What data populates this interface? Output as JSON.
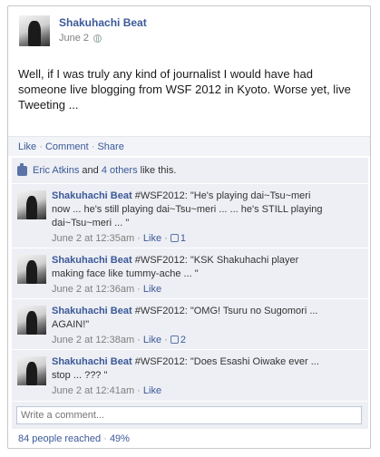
{
  "post": {
    "author": "Shakuhachi Beat",
    "date": "June 2",
    "text": "Well, if I was truly any kind of journalist I would have had someone live blogging from WSF 2012 in Kyoto. Worse yet, live Tweeting ...",
    "actions": {
      "like": "Like",
      "comment": "Comment",
      "share": "Share",
      "separator": "·"
    }
  },
  "likes": {
    "name": "Eric Atkins",
    "and": "and",
    "others": "4 others",
    "suffix": "like this."
  },
  "comments": [
    {
      "author": "Shakuhachi Beat",
      "text": "#WSF2012: \"He's playing dai~Tsu~meri now ... he's still playing dai~Tsu~meri ... ... he's STILL playing dai~Tsu~meri ... \"",
      "time": "June 2 at 12:35am",
      "like_label": "Like",
      "like_count": "1"
    },
    {
      "author": "Shakuhachi Beat",
      "text": "#WSF2012: \"KSK Shakuhachi player making face like tummy-ache ... \"",
      "time": "June 2 at 12:36am",
      "like_label": "Like",
      "like_count": ""
    },
    {
      "author": "Shakuhachi Beat",
      "text": "#WSF2012: \"OMG! Tsuru no Sugomori ... AGAIN!\"",
      "time": "June 2 at 12:38am",
      "like_label": "Like",
      "like_count": "2"
    },
    {
      "author": "Shakuhachi Beat",
      "text": "#WSF2012: \"Does Esashi Oiwake ever ... stop ... ??? \"",
      "time": "June 2 at 12:41am",
      "like_label": "Like",
      "like_count": ""
    }
  ],
  "write_comment": {
    "placeholder": "Write a comment..."
  },
  "reach": {
    "people": "84 people reached",
    "separator": "·",
    "percent": "49%"
  },
  "colors": {
    "link": "#3b5998",
    "feed_bg": "#edeff4",
    "action_bg": "#f2f4f8"
  }
}
